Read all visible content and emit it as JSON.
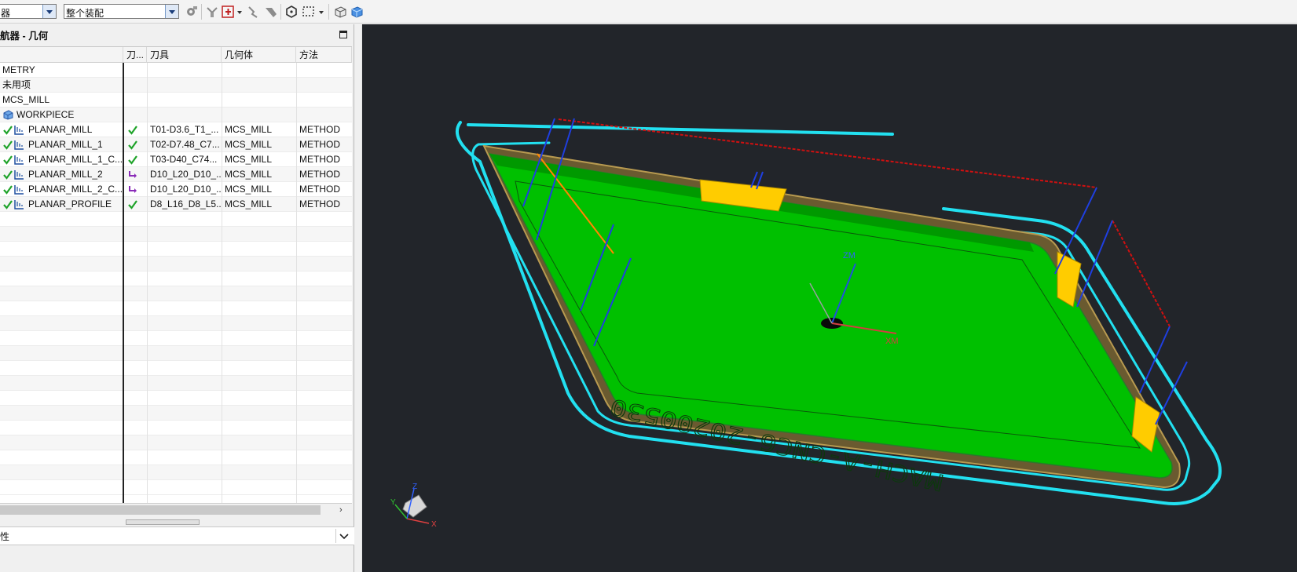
{
  "toolbar": {
    "filter_combo": "器",
    "scope_combo": "整个装配",
    "icons": [
      "gear-icon",
      "tool-path-icon",
      "operation-icon",
      "dropdown-arrow-icon",
      "pointer-icon",
      "hand-icon",
      "hexagon-icon",
      "select-rect-icon",
      "box-view-icon",
      "cube-view-icon"
    ]
  },
  "navigator": {
    "title": "航器 - 几何",
    "columns": [
      "",
      "刀...",
      "刀具",
      "几何体",
      "方法"
    ],
    "rows": [
      {
        "name": "METRY",
        "status": "",
        "tool": "",
        "geometry": "",
        "method": "",
        "indent": 0,
        "icon": "none",
        "op_check": false
      },
      {
        "name": "未用项",
        "status": "",
        "tool": "",
        "geometry": "",
        "method": "",
        "indent": 1,
        "icon": "none",
        "op_check": false
      },
      {
        "name": "MCS_MILL",
        "status": "",
        "tool": "",
        "geometry": "",
        "method": "",
        "indent": 1,
        "icon": "none",
        "op_check": false
      },
      {
        "name": "WORKPIECE",
        "status": "",
        "tool": "",
        "geometry": "",
        "method": "",
        "indent": 2,
        "icon": "workpiece",
        "op_check": false
      },
      {
        "name": "PLANAR_MILL",
        "status": "check",
        "tool": "T01-D3.6_T1_...",
        "geometry": "MCS_MILL",
        "method": "METHOD",
        "indent": 3,
        "icon": "op",
        "op_check": true
      },
      {
        "name": "PLANAR_MILL_1",
        "status": "check",
        "tool": "T02-D7.48_C7...",
        "geometry": "MCS_MILL",
        "method": "METHOD",
        "indent": 3,
        "icon": "op",
        "op_check": true
      },
      {
        "name": "PLANAR_MILL_1_C...",
        "status": "check",
        "tool": "T03-D40_C74...",
        "geometry": "MCS_MILL",
        "method": "METHOD",
        "indent": 3,
        "icon": "op",
        "op_check": true
      },
      {
        "name": "PLANAR_MILL_2",
        "status": "regen",
        "tool": "D10_L20_D10_...",
        "geometry": "MCS_MILL",
        "method": "METHOD",
        "indent": 3,
        "icon": "op",
        "op_check": true
      },
      {
        "name": "PLANAR_MILL_2_C...",
        "status": "regen",
        "tool": "D10_L20_D10_...",
        "geometry": "MCS_MILL",
        "method": "METHOD",
        "indent": 3,
        "icon": "op",
        "op_check": true
      },
      {
        "name": "PLANAR_PROFILE",
        "status": "check",
        "tool": "D8_L16_D8_L5...",
        "geometry": "MCS_MILL",
        "method": "METHOD",
        "indent": 3,
        "icon": "op",
        "op_check": true
      }
    ],
    "empty_rows": 19,
    "scroll_right": "›",
    "bottom_label": "性",
    "bottom_dropdown": "⌄"
  },
  "viewport": {
    "engraving_text": "MACH-A-CNC6-20200530",
    "axis_labels": {
      "zm": "ZM",
      "xm": "XM",
      "ym": "YM"
    },
    "triad": {
      "x": "X",
      "y": "Y",
      "z": "Z"
    }
  },
  "colors": {
    "part_green": "#00c000",
    "toolpath_cyan": "#22e0f0",
    "rapid_blue": "#1f3fe0",
    "rapid_red": "#d01010",
    "clamp_yellow": "#ffcc00",
    "status_check": "#1fa32a",
    "status_regen": "#8a2bb8",
    "viewport_bg": "#22252a"
  }
}
